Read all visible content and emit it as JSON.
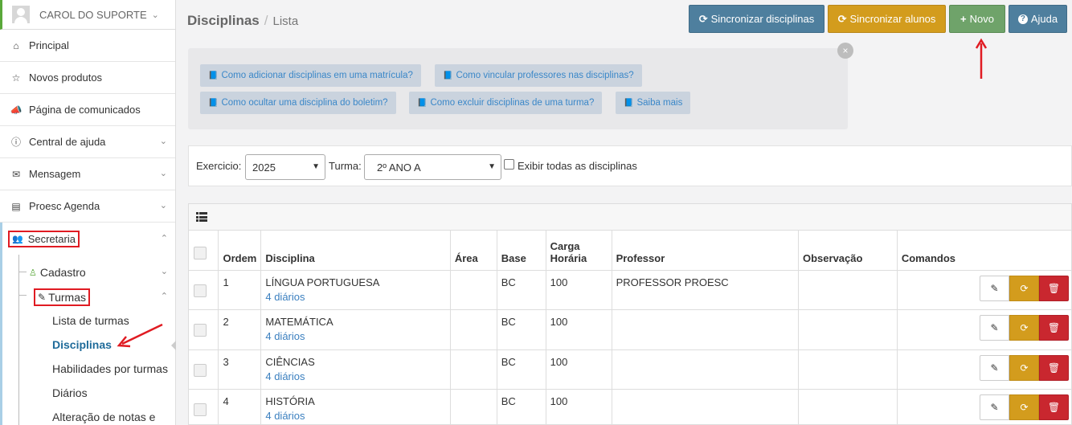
{
  "user": {
    "name": "CAROL DO SUPORTE"
  },
  "sidebar": {
    "items": [
      {
        "label": "Principal",
        "icon": "home-icon"
      },
      {
        "label": "Novos produtos",
        "icon": "star-icon"
      },
      {
        "label": "Página de comunicados",
        "icon": "megaphone-icon"
      },
      {
        "label": "Central de ajuda",
        "icon": "info-icon"
      },
      {
        "label": "Mensagem",
        "icon": "envelope-icon"
      },
      {
        "label": "Proesc Agenda",
        "icon": "agenda-icon"
      }
    ],
    "section": {
      "label": "Secretaria",
      "icon": "users-icon"
    },
    "cadastro": "Cadastro",
    "turmas": "Turmas",
    "leaves": [
      "Lista de turmas",
      "Disciplinas",
      "Habilidades por turmas",
      "Diários",
      "Alteração de notas e"
    ]
  },
  "header": {
    "title": "Disciplinas",
    "separator": "/",
    "crumb": "Lista",
    "buttons": {
      "sync_disciplinas": "Sincronizar disciplinas",
      "sync_alunos": "Sincronizar alunos",
      "novo": "Novo",
      "ajuda": "Ajuda"
    }
  },
  "help": {
    "close": "×",
    "links": [
      "Como adicionar disciplinas em uma matrícula?",
      "Como vincular professores nas disciplinas?",
      "Como ocultar uma disciplina do boletim?",
      "Como excluir disciplinas de uma turma?",
      "Saiba mais"
    ]
  },
  "filters": {
    "exercicio_label": "Exercicio:",
    "exercicio_value": "2025",
    "turma_label": "Turma:",
    "turma_value": "2º ANO A",
    "show_all_label": "Exibir todas as disciplinas"
  },
  "table": {
    "headers": {
      "ordem": "Ordem",
      "disciplina": "Disciplina",
      "area": "Área",
      "base": "Base",
      "carga1": "Carga",
      "carga2": "Horária",
      "professor": "Professor",
      "observacao": "Observação",
      "comandos": "Comandos"
    },
    "rows": [
      {
        "ordem": "1",
        "disciplina": "LÍNGUA PORTUGUESA",
        "diarios": "4 diários",
        "area": "",
        "base": "BC",
        "carga": "100",
        "professor": "PROFESSOR PROESC",
        "observacao": ""
      },
      {
        "ordem": "2",
        "disciplina": "MATEMÁTICA",
        "diarios": "4 diários",
        "area": "",
        "base": "BC",
        "carga": "100",
        "professor": "",
        "observacao": ""
      },
      {
        "ordem": "3",
        "disciplina": "CIÊNCIAS",
        "diarios": "4 diários",
        "area": "",
        "base": "BC",
        "carga": "100",
        "professor": "",
        "observacao": ""
      },
      {
        "ordem": "4",
        "disciplina": "HISTÓRIA",
        "diarios": "4 diários",
        "area": "",
        "base": "BC",
        "carga": "100",
        "professor": "",
        "observacao": ""
      }
    ]
  },
  "colors": {
    "accent_blue": "#4e7f9e",
    "accent_orange": "#d39c1d",
    "accent_green": "#6fa36a",
    "danger_red": "#c9272f",
    "annotation_red": "#e01b22",
    "active_link": "#1f6b9a"
  }
}
